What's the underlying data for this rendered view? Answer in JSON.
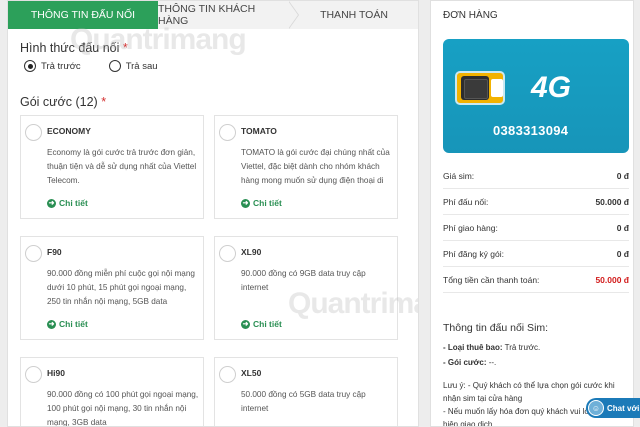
{
  "steps": [
    "THÔNG TIN ĐẤU NỐI",
    "THÔNG TIN KHÁCH HÀNG",
    "THANH TOÁN"
  ],
  "connection": {
    "label": "Hình thức đấu nối",
    "required_mark": "*",
    "options": [
      {
        "label": "Trả trước",
        "selected": true
      },
      {
        "label": "Trả sau",
        "selected": false
      }
    ]
  },
  "packages": {
    "label": "Gói cước (12)",
    "required_mark": "*",
    "detail_label": "Chi tiết",
    "items": [
      {
        "name": "ECONOMY",
        "desc": "Economy là gói cước trả trước đơn giản, thuận tiện và dễ sử dụng nhất của Viettel Telecom."
      },
      {
        "name": "TOMATO",
        "desc": "TOMATO là gói cước đại chúng nhất của Viettel, đặc biệt dành cho nhóm khách hàng mong muốn sử dụng điện thoại di"
      },
      {
        "name": "F90",
        "desc": "90.000 đồng miễn phí cuộc gọi nội mạng dưới 10 phút, 15 phút gọi ngoại mạng, 250 tin nhắn nội mạng, 5GB data"
      },
      {
        "name": "XL90",
        "desc": "90.000 đồng có 9GB data truy cập internet"
      },
      {
        "name": "Hi90",
        "desc": "90.000 đồng có 100 phút gọi ngoại mạng, 100 phút gọi nội mạng, 30 tin nhắn nội mạng, 3GB data"
      },
      {
        "name": "XL50",
        "desc": "50.000 đồng có 5GB data truy cập internet"
      }
    ]
  },
  "order": {
    "title": "ĐƠN HÀNG",
    "sim": {
      "network": "4G",
      "number": "0383313094"
    },
    "rows": [
      {
        "label": "Giá sim:",
        "value": "0 đ"
      },
      {
        "label": "Phí đấu nối:",
        "value": "50.000 đ"
      },
      {
        "label": "Phí giao hàng:",
        "value": "0 đ"
      },
      {
        "label": "Phí đăng ký gói:",
        "value": "0 đ"
      },
      {
        "label": "Tổng tiền cần thanh toán:",
        "value": "50.000 đ"
      }
    ],
    "info_title": "Thông tin đấu nối Sim:",
    "subscriber_type_label": "- Loại thuê bao:",
    "subscriber_type_value": "Trả trước.",
    "package_label": "- Gói cước:",
    "package_value": "--.",
    "note_1": "Lưu ý: - Quý khách có thể lựa chọn gói cước khi nhận sim tại cửa hàng",
    "note_2": "- Nếu muốn lấy hóa đơn quý khách vui lòng thực hiện giao dịch."
  },
  "chat": {
    "label": "Chat với"
  },
  "watermark": "Quantrimang",
  "colors": {
    "accent": "#2ca05a",
    "total": "#d21c1c",
    "sim": "#17a0c4"
  }
}
